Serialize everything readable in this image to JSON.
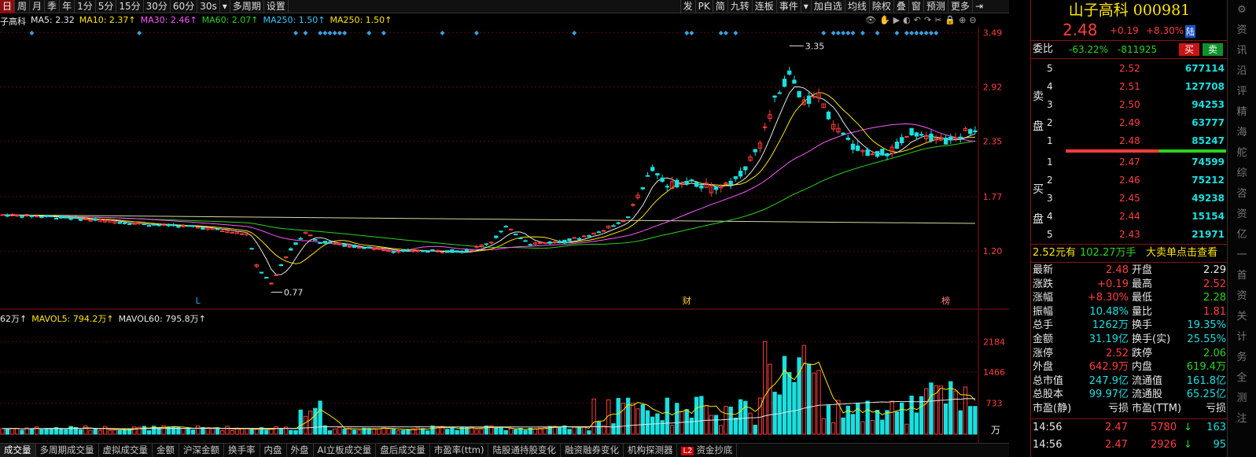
{
  "toolbar": {
    "periods": [
      "日",
      "周",
      "月",
      "季",
      "年",
      "1分",
      "5分",
      "15分",
      "30分",
      "60分",
      "30s",
      "▾",
      "多周期",
      "设置"
    ],
    "active_period": 0,
    "right_items": [
      "发",
      "PK",
      "简",
      "九转",
      "连板",
      "事件",
      "▾",
      "加自选",
      "均线",
      "除权",
      "叠",
      "窗",
      "预测",
      "更多",
      "⇥"
    ]
  },
  "ma_legend": {
    "name": "子高科",
    "items": [
      {
        "text": "MA5: 2.32",
        "color": "#e8e8e8"
      },
      {
        "text": "MA10: 2.37↑",
        "color": "#ffe600"
      },
      {
        "text": "MA30: 2.46↑",
        "color": "#ff55ff"
      },
      {
        "text": "MA60: 2.07↑",
        "color": "#2bd41d"
      },
      {
        "text": "MA250: 1.50↑",
        "color": "#33ccff"
      },
      {
        "text": "MA250: 1.50↑",
        "color": "#ffe600"
      }
    ]
  },
  "chart_icons": [
    "👁",
    "✋",
    "▶",
    "◐",
    "↶",
    "↷",
    "✂",
    "🔒",
    "⊕",
    "⊖"
  ],
  "vol_legend": {
    "items": [
      {
        "text": "62万↑",
        "color": "#e8e8e8"
      },
      {
        "text": "MAVOL5: 794.2万↑",
        "color": "#ffe600"
      },
      {
        "text": "MAVOL60: 795.8万↑",
        "color": "#e8e8e8"
      }
    ]
  },
  "chart_data": [
    {
      "type": "candlestick",
      "price_axis_ticks": [
        "3.49",
        "2.92",
        "2.35",
        "1.77",
        "1.20"
      ],
      "ylim": [
        0.65,
        3.55
      ],
      "annotations": [
        {
          "text": "3.35",
          "value": 3.35
        },
        {
          "text": "0.77",
          "value": 0.77
        }
      ],
      "markers": [
        "L",
        "财",
        "榜"
      ],
      "ma_colors": {
        "ma5": "#e8e8e8",
        "ma10": "#ffe600",
        "ma30": "#ff55ff",
        "ma60": "#2bd41d",
        "ma250": "#d8d8a0"
      }
    },
    {
      "type": "bar",
      "title": "volume",
      "volume_axis_ticks": [
        "2184",
        "1466",
        "733"
      ],
      "unit": "万",
      "ylim": [
        0,
        2600
      ]
    }
  ],
  "panel": {
    "title": "山子高科 000981",
    "price": "2.48",
    "change": "+0.19",
    "change_pct": "+8.30%",
    "badge": "陆",
    "weibi_label": "委比",
    "weibi_pct": "-63.22%",
    "weibi_diff": "-811925",
    "buy_btn": "买",
    "sell_btn": "卖",
    "sell_label": [
      "卖",
      "盘"
    ],
    "buy_label": [
      "买",
      "盘"
    ],
    "asks": [
      {
        "level": "5",
        "price": "2.52",
        "vol": "677114"
      },
      {
        "level": "4",
        "price": "2.51",
        "vol": "127708"
      },
      {
        "level": "3",
        "price": "2.50",
        "vol": "94253"
      },
      {
        "level": "2",
        "price": "2.49",
        "vol": "63777"
      },
      {
        "level": "1",
        "price": "2.48",
        "vol": "85247"
      }
    ],
    "bids": [
      {
        "level": "1",
        "price": "2.47",
        "vol": "74599"
      },
      {
        "level": "2",
        "price": "2.46",
        "vol": "75212"
      },
      {
        "level": "3",
        "price": "2.45",
        "vol": "49238"
      },
      {
        "level": "4",
        "price": "2.44",
        "vol": "15154"
      },
      {
        "level": "5",
        "price": "2.43",
        "vol": "21971"
      }
    ],
    "big_order": {
      "price": "2.52元有",
      "amount": "102.27万手",
      "text": "大卖单点击查看"
    },
    "quotes": [
      {
        "l1": "最新",
        "v1": "2.48",
        "c1": "red",
        "l2": "开盘",
        "v2": "2.29",
        "c2": "white"
      },
      {
        "l1": "涨跌",
        "v1": "+0.19",
        "c1": "red",
        "l2": "最高",
        "v2": "2.52",
        "c2": "red"
      },
      {
        "l1": "涨幅",
        "v1": "+8.30%",
        "c1": "red",
        "l2": "最低",
        "v2": "2.28",
        "c2": "green"
      },
      {
        "l1": "振幅",
        "v1": "10.48%",
        "c1": "cyan",
        "l2": "量比",
        "v2": "1.81",
        "c2": "red"
      },
      {
        "l1": "总手",
        "v1": "1262万",
        "c1": "cyan",
        "l2": "换手",
        "v2": "19.35%",
        "c2": "cyan"
      },
      {
        "l1": "金额",
        "v1": "31.19亿",
        "c1": "cyan",
        "l2": "换手(实)",
        "v2": "25.55%",
        "c2": "cyan"
      },
      {
        "l1": "涨停",
        "v1": "2.52",
        "c1": "red",
        "l2": "跌停",
        "v2": "2.06",
        "c2": "green"
      },
      {
        "l1": "外盘",
        "v1": "642.9万",
        "c1": "red",
        "l2": "内盘",
        "v2": "619.4万",
        "c2": "green"
      },
      {
        "l1": "总市值",
        "v1": "247.9亿",
        "c1": "cyan",
        "l2": "流通值",
        "v2": "161.8亿",
        "c2": "cyan"
      },
      {
        "l1": "总股本",
        "v1": "99.97亿",
        "c1": "cyan",
        "l2": "流通股",
        "v2": "65.25亿",
        "c2": "cyan"
      },
      {
        "l1": "市盈(静)",
        "v1": "亏损",
        "c1": "white",
        "l2": "市盈(TTM)",
        "v2": "亏损",
        "c2": "white"
      }
    ],
    "ticks": [
      {
        "time": "14:56",
        "price": "2.47",
        "vol": "5780",
        "dir": "↓",
        "num": "163"
      },
      {
        "time": "14:56",
        "price": "2.47",
        "vol": "2926",
        "dir": "↓",
        "num": "95"
      }
    ]
  },
  "side_strip": [
    "⚙",
    "资",
    "讯",
    "沿",
    "评",
    "精",
    "海",
    "舵",
    "综",
    "咨",
    "资",
    "亿",
    "一",
    "首",
    "资",
    "关",
    "计",
    "务",
    "全",
    "测",
    "注"
  ],
  "bottom_tabs": [
    {
      "label": "成交量",
      "active": true,
      "l2": false
    },
    {
      "label": "多周期成交量",
      "active": false,
      "l2": false
    },
    {
      "label": "虚拟成交量",
      "active": false,
      "l2": false
    },
    {
      "label": "金额",
      "active": false,
      "l2": false
    },
    {
      "label": "沪深金额",
      "active": false,
      "l2": false
    },
    {
      "label": "换手率",
      "active": false,
      "l2": false
    },
    {
      "label": "内盘",
      "active": false,
      "l2": false
    },
    {
      "label": "外盘",
      "active": false,
      "l2": false
    },
    {
      "label": "AI立板成交量",
      "active": false,
      "l2": false
    },
    {
      "label": "盘后成交量",
      "active": false,
      "l2": false
    },
    {
      "label": "市盈率(ttm)",
      "active": false,
      "l2": false
    },
    {
      "label": "陆股通持股变化",
      "active": false,
      "l2": false
    },
    {
      "label": "融资融券变化",
      "active": false,
      "l2": false
    },
    {
      "label": "机构探测器",
      "active": false,
      "l2": false
    },
    {
      "label": "资金抄底",
      "active": false,
      "l2": true
    }
  ]
}
